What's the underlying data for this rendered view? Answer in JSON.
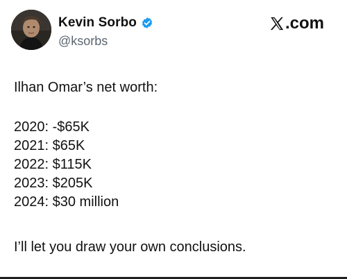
{
  "post": {
    "author": {
      "display_name": "Kevin Sorbo",
      "handle": "@ksorbs",
      "verified_icon": "verified-badge-icon",
      "verified_color": "#1d9bf0"
    },
    "brand": {
      "logo_icon": "x-logo-icon",
      "suffix": ".com"
    },
    "text": {
      "intro": "Ilhan Omar’s net worth:",
      "entries": [
        "2020: -$65K",
        "2021: $65K",
        "2022: $115K",
        "2023: $205K",
        "2024: $30 million"
      ],
      "closing": "I’ll let you draw your own conclusions."
    }
  }
}
